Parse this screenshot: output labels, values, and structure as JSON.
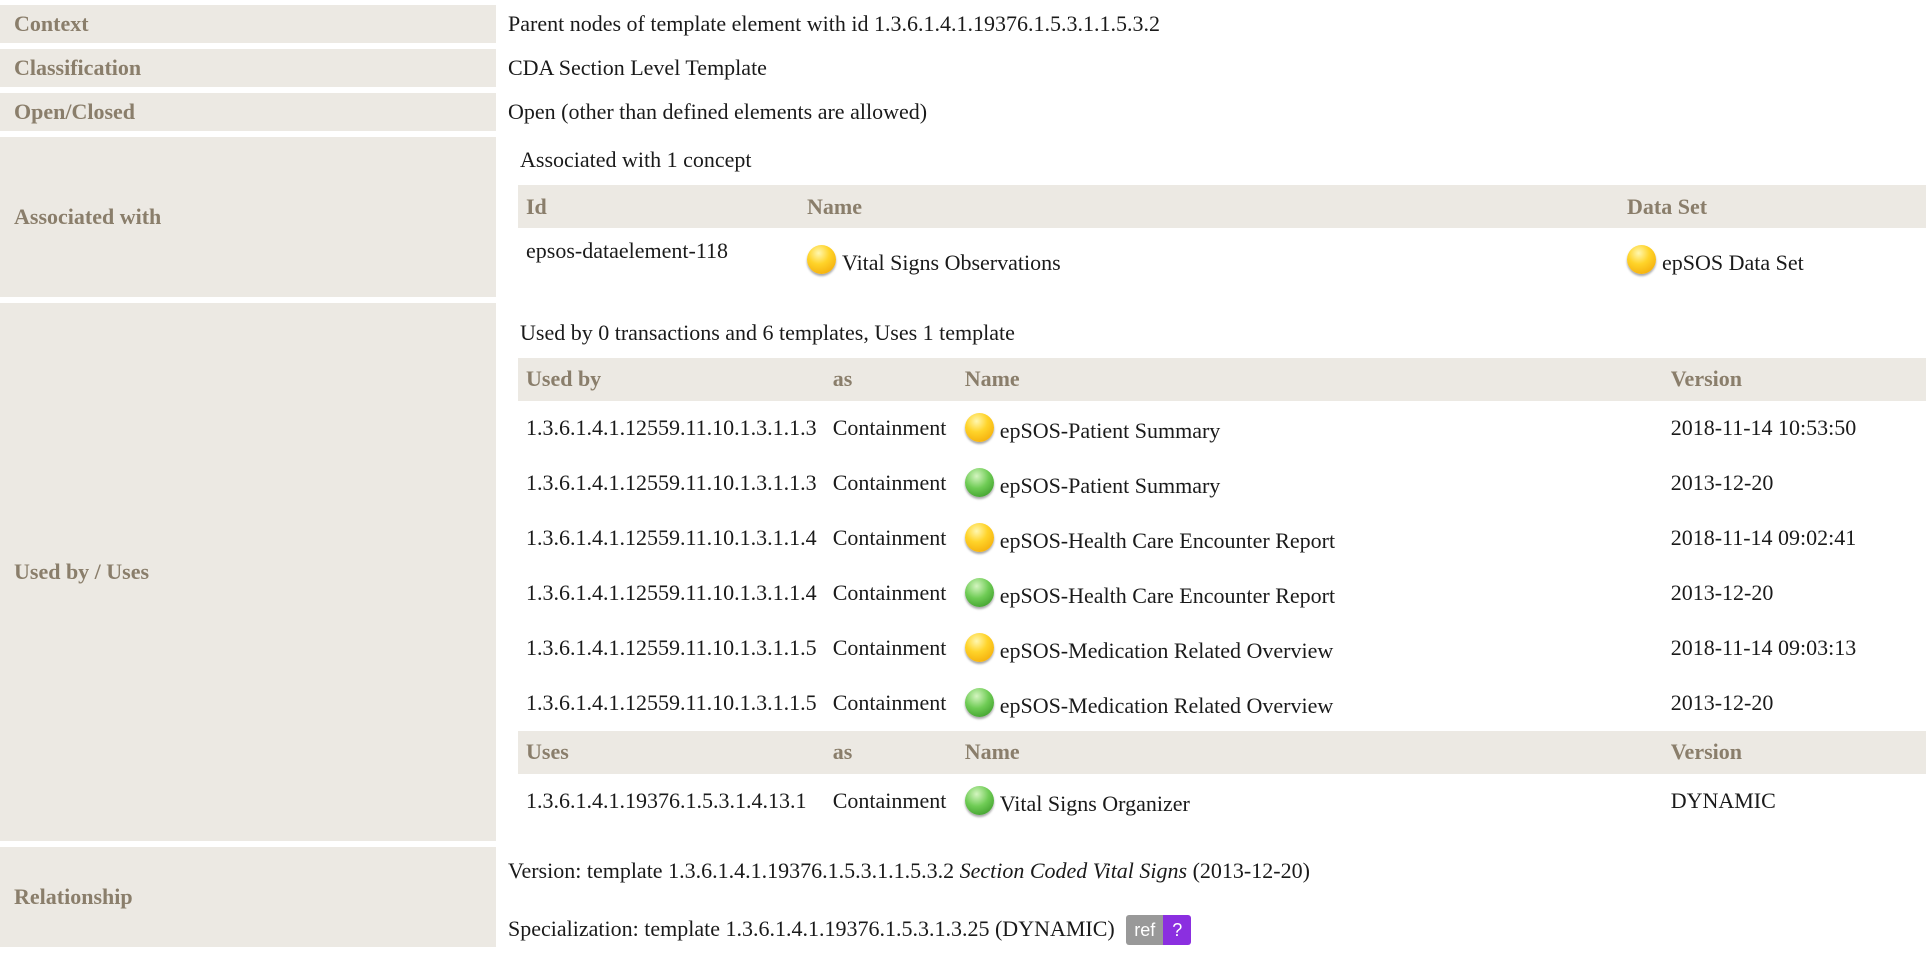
{
  "context": {
    "label": "Context",
    "value": "Parent nodes of template element with id 1.3.6.1.4.1.19376.1.5.3.1.1.5.3.2"
  },
  "classification": {
    "label": "Classification",
    "value": "CDA Section Level Template"
  },
  "open_closed": {
    "label": "Open/Closed",
    "value": "Open (other than defined elements are allowed)"
  },
  "associated": {
    "label": "Associated with",
    "intro": "Associated with 1 concept",
    "headers": {
      "id": "Id",
      "name": "Name",
      "dataset": "Data Set"
    },
    "rows": [
      {
        "id": "epsos-dataelement-118",
        "name": "Vital Signs Observations",
        "name_status": "draft",
        "dataset": "epSOS Data Set",
        "dataset_status": "draft"
      }
    ]
  },
  "used_by": {
    "label": "Used by / Uses",
    "intro": "Used by 0 transactions and 6 templates, Uses 1 template",
    "headers": {
      "used_by": "Used by",
      "as": "as",
      "name": "Name",
      "version": "Version"
    },
    "rows": [
      {
        "id": "1.3.6.1.4.1.12559.11.10.1.3.1.1.3",
        "as": "Containment",
        "status": "draft",
        "name": "epSOS-Patient Summary",
        "version": "2018-11-14 10:53:50"
      },
      {
        "id": "1.3.6.1.4.1.12559.11.10.1.3.1.1.3",
        "as": "Containment",
        "status": "final",
        "name": "epSOS-Patient Summary",
        "version": "2013-12-20"
      },
      {
        "id": "1.3.6.1.4.1.12559.11.10.1.3.1.1.4",
        "as": "Containment",
        "status": "draft",
        "name": "epSOS-Health Care Encounter Report",
        "version": "2018-11-14 09:02:41"
      },
      {
        "id": "1.3.6.1.4.1.12559.11.10.1.3.1.1.4",
        "as": "Containment",
        "status": "final",
        "name": "epSOS-Health Care Encounter Report",
        "version": "2013-12-20"
      },
      {
        "id": "1.3.6.1.4.1.12559.11.10.1.3.1.1.5",
        "as": "Containment",
        "status": "draft",
        "name": "epSOS-Medication Related Overview",
        "version": "2018-11-14 09:03:13"
      },
      {
        "id": "1.3.6.1.4.1.12559.11.10.1.3.1.1.5",
        "as": "Containment",
        "status": "final",
        "name": "epSOS-Medication Related Overview",
        "version": "2013-12-20"
      }
    ],
    "uses_headers": {
      "uses": "Uses",
      "as": "as",
      "name": "Name",
      "version": "Version"
    },
    "uses_rows": [
      {
        "id": "1.3.6.1.4.1.19376.1.5.3.1.4.13.1",
        "as": "Containment",
        "status": "final",
        "name": "Vital Signs Organizer",
        "version": "DYNAMIC"
      }
    ]
  },
  "relationship": {
    "label": "Relationship",
    "version_prefix": "Version: template 1.3.6.1.4.1.19376.1.5.3.1.1.5.3.2 ",
    "version_name": "Section Coded Vital Signs",
    "version_suffix": " (2013-12-20)",
    "specialization": "Specialization: template 1.3.6.1.4.1.19376.1.5.3.1.3.25 (DYNAMIC)",
    "badge_ref": "ref",
    "badge_help": "?"
  },
  "colors": {
    "label_bg": "#ece9e3",
    "label_text": "#8a7e6b",
    "status_draft": "#ffd42a",
    "status_final": "#6fcc55",
    "badge_help": "#8b2fe0"
  }
}
